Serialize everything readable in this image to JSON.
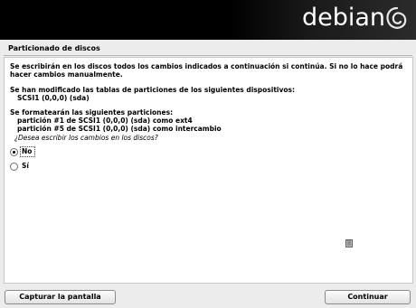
{
  "header": {
    "logo_text": "debian",
    "logo_icon": "debian-swirl-icon"
  },
  "page": {
    "title": "Particionado de discos"
  },
  "content": {
    "paragraph1_line1": "Se escribirán en los discos todos los cambios indicados a continuación si continúa. Si no lo hace podrá",
    "paragraph1_line2": "hacer cambios manualmente.",
    "paragraph2_line1": "Se han modificado las tablas de particiones de los siguientes dispositivos:",
    "device": "SCSI1 (0,0,0) (sda)",
    "paragraph3_line1": "Se formatearán las siguientes particiones:",
    "partition1": "partición #1 de SCSI1 (0,0,0) (sda) como ext4",
    "partition2": "partición #5 de SCSI1 (0,0,0) (sda) como intercambio",
    "question": "¿Desea escribir los cambios en los discos?"
  },
  "options": [
    {
      "label": "No",
      "selected": true
    },
    {
      "label": "Sí",
      "selected": false
    }
  ],
  "buttons": {
    "screenshot": "Capturar la pantalla",
    "continue": "Continuar"
  },
  "colors": {
    "banner": "#000000",
    "window_bg": "#ececec",
    "panel_bg": "#ffffff"
  }
}
